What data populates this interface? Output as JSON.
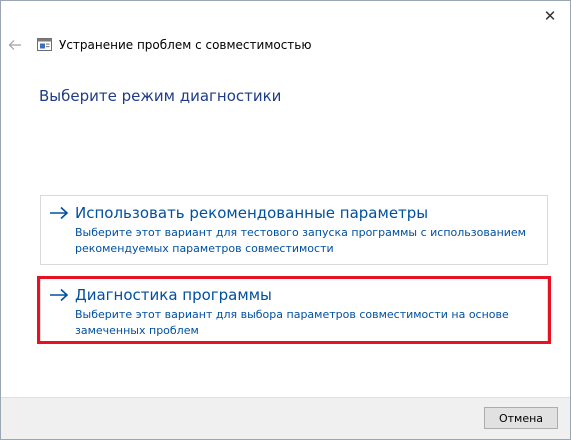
{
  "window": {
    "title": "Устранение проблем с совместимостью",
    "close_glyph": "✕"
  },
  "heading": "Выберите режим диагностики",
  "options": [
    {
      "title": "Использовать рекомендованные параметры",
      "description": "Выберите этот вариант для тестового запуска программы с использованием рекомендуемых параметров совместимости"
    },
    {
      "title": "Диагностика программы",
      "description": "Выберите этот вариант для выбора параметров совместимости на основе замеченных проблем"
    }
  ],
  "footer": {
    "cancel_label": "Отмена"
  },
  "colors": {
    "link_blue": "#0050a0",
    "heading_blue": "#1f3c88",
    "highlight_red": "#e81123"
  },
  "icons": {
    "back": "back-arrow-icon",
    "app": "compatibility-troubleshooter-icon",
    "option_arrow": "right-arrow-icon",
    "close": "close-icon"
  }
}
